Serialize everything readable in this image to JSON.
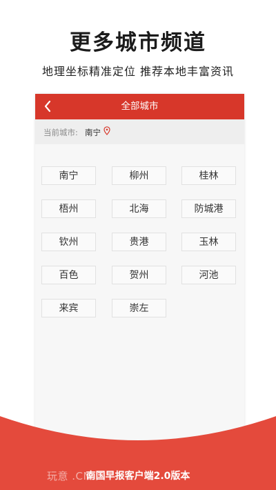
{
  "promo": {
    "title": "更多城市频道",
    "subtitle": "地理坐标精准定位  推荐本地丰富资讯"
  },
  "app": {
    "header_title": "全部城市",
    "header_color": "#d7372a",
    "back_icon": "chevron-left-icon",
    "current_city_label": "当前城市:",
    "current_city": "南宁",
    "pin_icon": "location-pin-icon"
  },
  "cities": [
    "南宁",
    "柳州",
    "桂林",
    "梧州",
    "北海",
    "防城港",
    "钦州",
    "贵港",
    "玉林",
    "百色",
    "贺州",
    "河池",
    "来宾",
    "崇左"
  ],
  "footer": {
    "text": "南国早报客户端2.0版本",
    "watermark": "玩意       .CN",
    "wave_color": "#e44a3c"
  }
}
